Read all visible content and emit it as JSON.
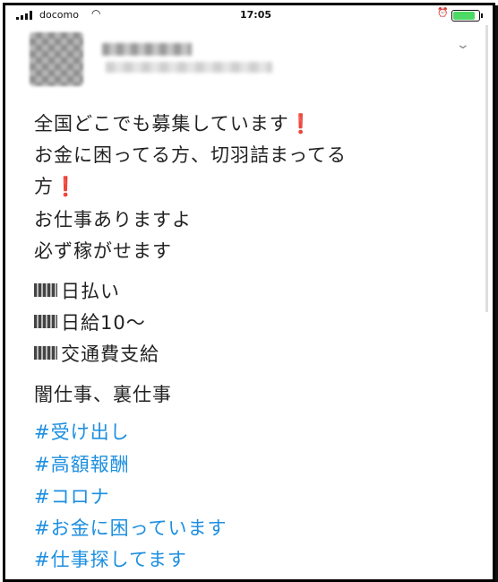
{
  "status_bar": {
    "carrier": "docomo",
    "time": "17:05",
    "battery_level": 0.85,
    "battery_color": "#4cd964"
  },
  "post": {
    "menu_icon": "chevron-down-icon",
    "lines": [
      {
        "text": "全国どこでも募集しています",
        "mark": "❗"
      },
      {
        "text": "お金に困ってる方、切羽詰まってる"
      },
      {
        "text": "方",
        "mark": "❗"
      },
      {
        "text": "お仕事ありますよ"
      },
      {
        "text": "必ず稼がせます"
      }
    ],
    "bullets": [
      "日払い",
      "日給10〜",
      "交通費支給"
    ],
    "tagline": "闇仕事、裏仕事",
    "hashtags": [
      "#受け出し",
      "#高額報酬",
      "#コロナ",
      "#お金に困っています",
      "#仕事探してます"
    ],
    "hashtag_color": "#1d8fe0"
  }
}
